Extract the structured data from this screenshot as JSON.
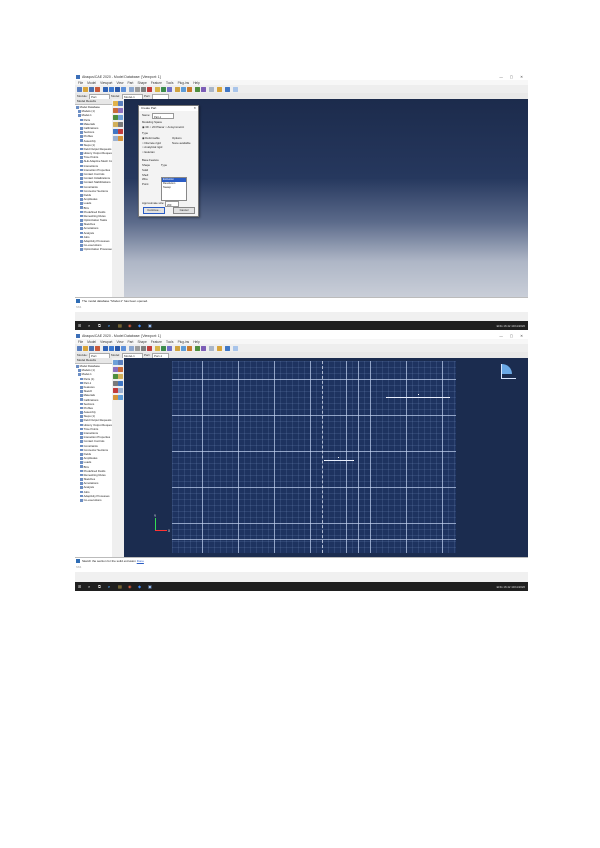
{
  "app": {
    "title": "Abaqus/CAE 2020 - Model Database: [Viewport: 1]",
    "window_controls": "—  ▢  ✕",
    "menu": [
      "File",
      "Model",
      "Viewport",
      "View",
      "Part",
      "Shape",
      "Feature",
      "Tools",
      "Plug-ins",
      "Help"
    ]
  },
  "shot1": {
    "context": {
      "module_label": "Module:",
      "module_value": "Part",
      "model_label": "Model:",
      "model_value": "Model-1",
      "part_label": "Part:",
      "part_value": ""
    },
    "tree_tabs": "Model  Results",
    "tree_items": [
      "Model Database",
      "Models (1)",
      "Model-1",
      "Parts",
      "Materials",
      "Calibrations",
      "Sections",
      "Profiles",
      "Assembly",
      "Steps (1)",
      "Field Output Requests",
      "History Output Requests",
      "Time Points",
      "ALE Adaptive Mesh Constraints",
      "Interactions",
      "Interaction Properties",
      "Contact Controls",
      "Contact Initializations",
      "Contact Stabilizations",
      "Constraints",
      "Connector Sections",
      "Fields",
      "Amplitudes",
      "Loads",
      "BCs",
      "Predefined Fields",
      "Remeshing Rules",
      "Optimization Tasks",
      "Sketches",
      "Annotations",
      "Analysis",
      "Jobs",
      "Adaptivity Processes",
      "Co-executions",
      "Optimization Processes"
    ],
    "dialog": {
      "title": "Create Part",
      "close": "✕",
      "name_label": "Name:",
      "name_value": "Part-1",
      "space_label": "Modeling Space",
      "space_options": "◉ 3D  ○ 2D Planar  ○ Axisymmetric",
      "type_label": "Type",
      "type_value": "◉ Deformable",
      "type_options": [
        "○ Discrete rigid",
        "○ Analytical rigid",
        "○ Eulerian"
      ],
      "options_label": "Options",
      "options_value": "None available",
      "base_label": "Base Feature",
      "shape_label": "Shape",
      "shape_col_type": "Type",
      "shapes": [
        "Solid",
        "Shell",
        "Wire",
        "Point"
      ],
      "base_types": [
        "Extrusion",
        "Revolution",
        "Sweep"
      ],
      "approx_label": "Approximate size:",
      "approx_value": "200",
      "continue": "Continue...",
      "cancel": "Cancel"
    },
    "message": "The model database \"Model-1\" has been opened.",
    "prompt_bracket": ">>>"
  },
  "shot2": {
    "context": {
      "module_label": "Module:",
      "module_value": "Part",
      "model_label": "Model:",
      "model_value": "Model-1",
      "part_label": "Part:",
      "part_value": "Part-1"
    },
    "tree_tabs": "Model  Results",
    "tree_items": [
      "Model Database",
      "Models (1)",
      "Model-1",
      "Parts (1)",
      "Part-1",
      "Features",
      "Sketch",
      "Materials",
      "Calibrations",
      "Sections",
      "Profiles",
      "Assembly",
      "Steps (1)",
      "Field Output Requests",
      "History Output Requests",
      "Time Points",
      "Interactions",
      "Interaction Properties",
      "Contact Controls",
      "Constraints",
      "Connector Sections",
      "Fields",
      "Amplitudes",
      "Loads",
      "BCs",
      "Predefined Fields",
      "Remeshing Rules",
      "Sketches",
      "Annotations",
      "Analysis",
      "Jobs",
      "Adaptivity Processes",
      "Co-executions"
    ],
    "triad": {
      "y": "Y",
      "x": "X"
    },
    "message": "Sketch the section for the solid extrusion",
    "done_label": "Done",
    "prompt_bracket": ">>>"
  },
  "taskbar": {
    "icons": [
      "⊞",
      "⌕",
      "⧉",
      "e",
      "▤",
      "◉",
      "◆",
      "▣"
    ],
    "tray": "ENG  16:42  10/11/2020"
  },
  "colors": {
    "viewport_dark": "#1c2b4c",
    "sketch_grid": "#1e3360",
    "selection_blue": "#2a5cc4",
    "triad_x": "#ff3333",
    "triad_y": "#33dd55"
  }
}
